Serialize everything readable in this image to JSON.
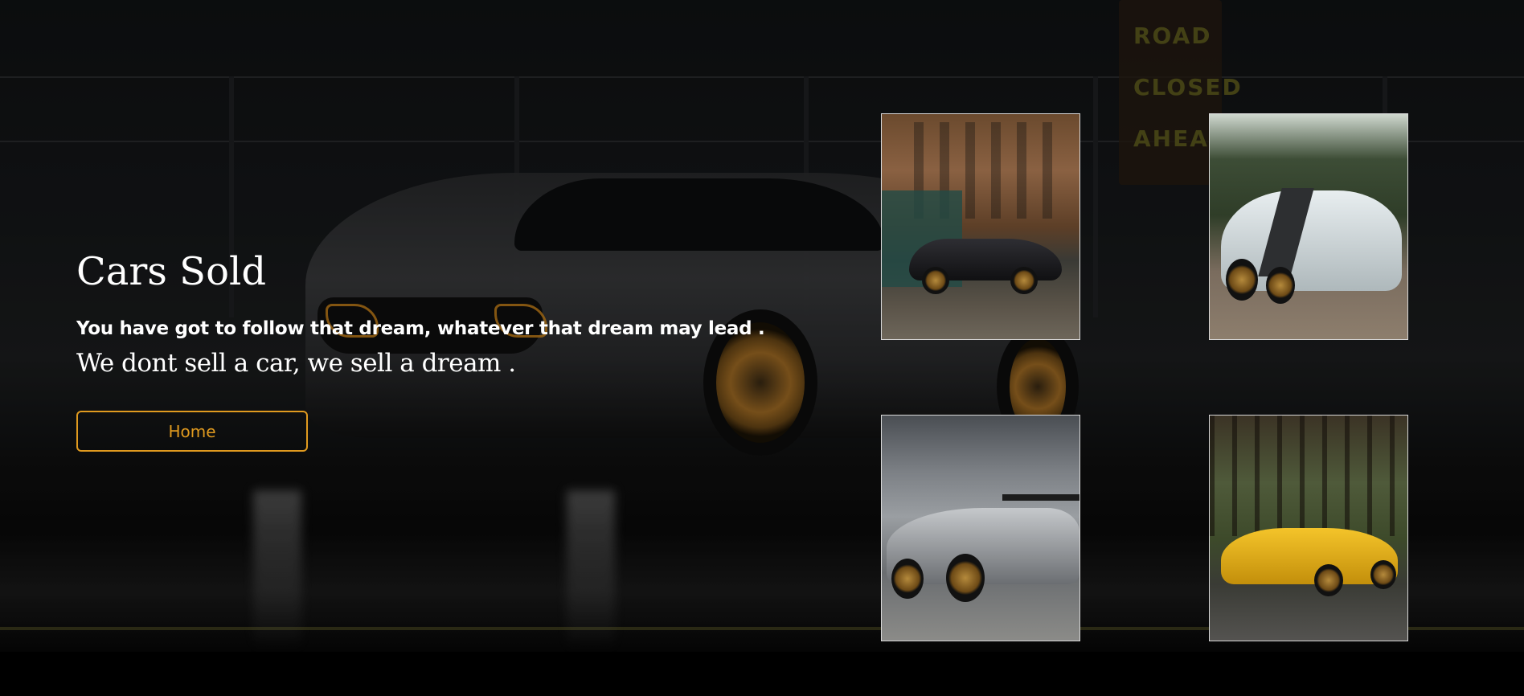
{
  "hero": {
    "title": "Cars Sold",
    "subtitle": "You have got to follow that dream, whatever that dream may lead .",
    "tagline": "We dont sell a car, we sell a dream .",
    "home_button_label": "Home"
  },
  "background": {
    "sign_lines": [
      "ROAD",
      "CLOSED",
      "AHEAD"
    ]
  },
  "colors": {
    "accent": "#e09a1f",
    "text": "#ffffff",
    "page_bottom": "#000000"
  },
  "gallery": {
    "tiles": [
      {
        "subject": "black hypercar on city street"
      },
      {
        "subject": "white sports car on forest road"
      },
      {
        "subject": "grey supercar with rear wing under cloudy sky"
      },
      {
        "subject": "yellow supercar in forest"
      }
    ]
  }
}
